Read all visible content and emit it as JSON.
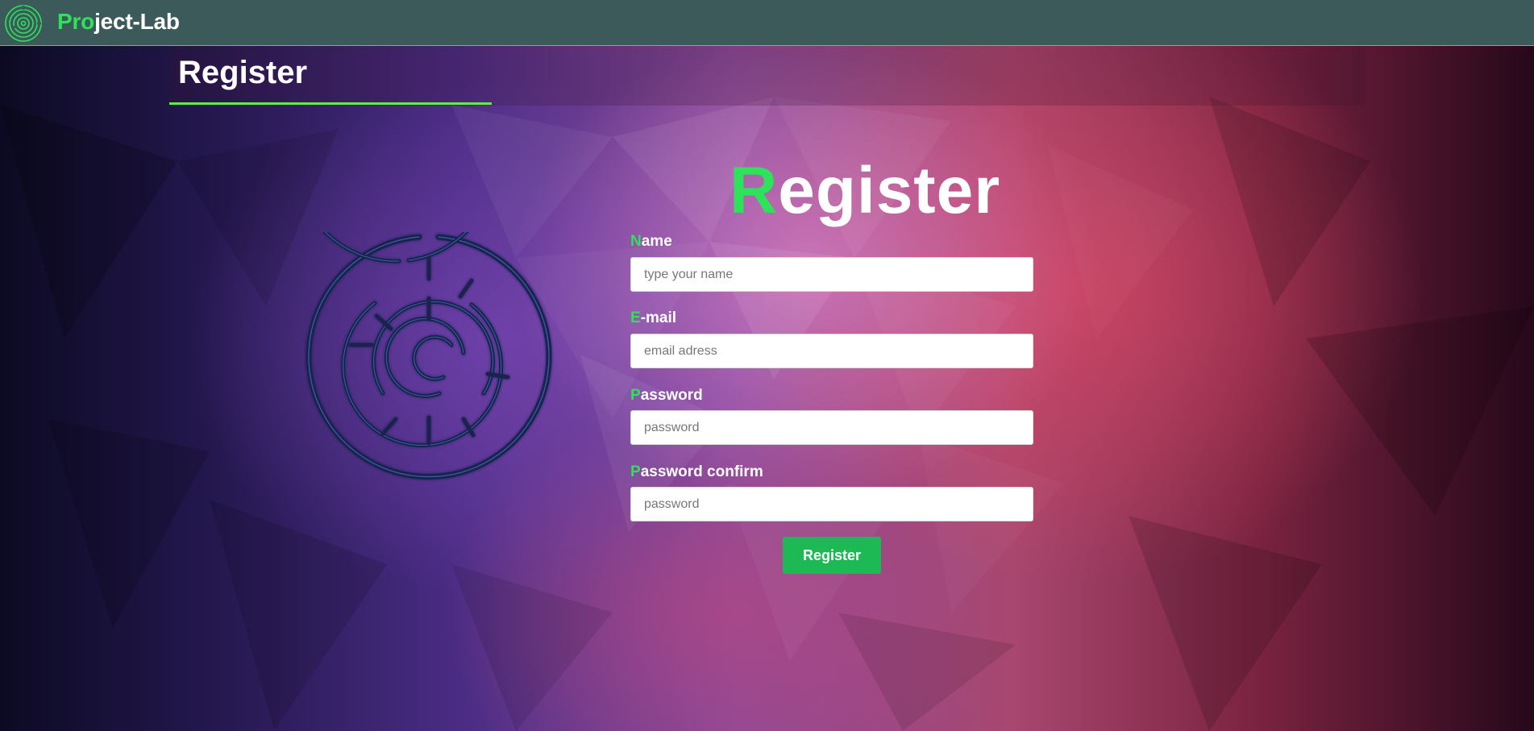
{
  "navbar": {
    "brand_accent": "Pro",
    "brand_rest": "ject-Lab",
    "logo_icon": "maze-logo-icon"
  },
  "page_header": {
    "title": "Register"
  },
  "form": {
    "title_first_letter": "R",
    "title_rest": "egister",
    "fields": [
      {
        "label_first_letter": "N",
        "label_rest": "ame",
        "placeholder": "type your name",
        "type": "text"
      },
      {
        "label_first_letter": "E",
        "label_rest": "-mail",
        "placeholder": "email adress",
        "type": "email"
      },
      {
        "label_first_letter": "P",
        "label_rest": "assword",
        "placeholder": "password",
        "type": "password"
      },
      {
        "label_first_letter": "P",
        "label_rest": "assword confirm",
        "placeholder": "password",
        "type": "password"
      }
    ],
    "submit_label": "Register"
  },
  "illustration": {
    "icon": "maze-icon"
  },
  "colors": {
    "accent_green": "#2ee25a",
    "button_green": "#1db954",
    "navbar": "#3c5a5a",
    "underline": "#5ef23d"
  }
}
